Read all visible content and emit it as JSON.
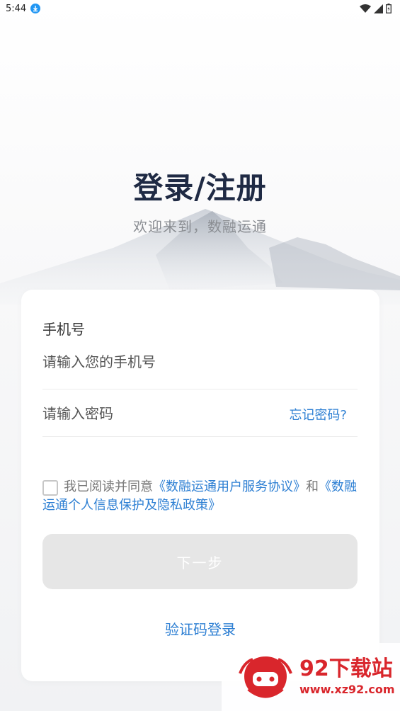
{
  "status_bar": {
    "time": "5:44",
    "icons": [
      "download-icon",
      "wifi-icon",
      "signal-icon",
      "battery-icon"
    ]
  },
  "header": {
    "title": "登录/注册",
    "subtitle": "欢迎来到，数融运通"
  },
  "form": {
    "phone_label": "手机号",
    "phone_placeholder": "请输入您的手机号",
    "phone_value": "",
    "password_placeholder": "请输入密码",
    "password_value": "",
    "forgot_password": "忘记密码?",
    "agreement": {
      "checked": false,
      "prefix": "我已阅读并同意",
      "user_agreement": "《数融运通用户服务协议》",
      "conjunction": "和",
      "privacy_policy": "《数融运通个人信息保护及隐私政策》"
    },
    "next_button": "下一步",
    "sms_login": "验证码登录"
  },
  "watermark": {
    "name": "92下载站",
    "url": "www.xz92.com"
  },
  "colors": {
    "title": "#1f2a44",
    "link": "#2d7fd3",
    "button_disabled": "#e6e6e6",
    "watermark": "#d9262c"
  }
}
